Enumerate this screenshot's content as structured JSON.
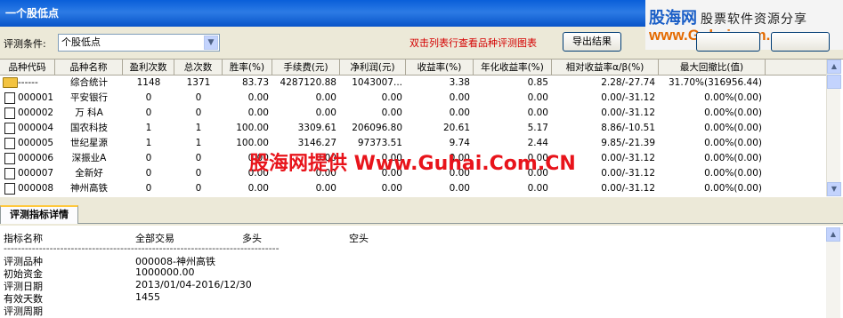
{
  "window": {
    "title": "一个股低点"
  },
  "watermark_logo": {
    "brand": "股海网",
    "slogan": "股票软件资源分享",
    "url": "www.Guhai.com.cn"
  },
  "condition": {
    "label": "评测条件:",
    "selected": "个股低点"
  },
  "hint": "双击列表行查看品种评测图表",
  "buttons": {
    "export": "导出结果"
  },
  "table": {
    "columns": [
      "品种代码",
      "品种名称",
      "盈利次数",
      "总次数",
      "胜率(%)",
      "手续费(元)",
      "净利润(元)",
      "收益率(%)",
      "年化收益率(%)",
      "相对收益率α/β(%)",
      "最大回撤比(值)"
    ],
    "rows": [
      {
        "icon": "folder",
        "code": "------",
        "name": "综合统计",
        "wins": "1148",
        "total": "1371",
        "winrate": "83.73",
        "fee": "4287120.88",
        "profit": "1043007...",
        "ret": "3.38",
        "annual": "0.85",
        "relative": "2.28/-27.74",
        "maxdd": "31.70%(316956.44)"
      },
      {
        "icon": "doc",
        "code": "000001",
        "name": "平安银行",
        "wins": "0",
        "total": "0",
        "winrate": "0.00",
        "fee": "0.00",
        "profit": "0.00",
        "ret": "0.00",
        "annual": "0.00",
        "relative": "0.00/-31.12",
        "maxdd": "0.00%(0.00)"
      },
      {
        "icon": "doc",
        "code": "000002",
        "name": "万 科A",
        "wins": "0",
        "total": "0",
        "winrate": "0.00",
        "fee": "0.00",
        "profit": "0.00",
        "ret": "0.00",
        "annual": "0.00",
        "relative": "0.00/-31.12",
        "maxdd": "0.00%(0.00)"
      },
      {
        "icon": "doc",
        "code": "000004",
        "name": "国农科技",
        "wins": "1",
        "total": "1",
        "winrate": "100.00",
        "fee": "3309.61",
        "profit": "206096.80",
        "ret": "20.61",
        "annual": "5.17",
        "relative": "8.86/-10.51",
        "maxdd": "0.00%(0.00)"
      },
      {
        "icon": "doc",
        "code": "000005",
        "name": "世纪星源",
        "wins": "1",
        "total": "1",
        "winrate": "100.00",
        "fee": "3146.27",
        "profit": "97373.51",
        "ret": "9.74",
        "annual": "2.44",
        "relative": "9.85/-21.39",
        "maxdd": "0.00%(0.00)"
      },
      {
        "icon": "doc",
        "code": "000006",
        "name": "深振业A",
        "wins": "0",
        "total": "0",
        "winrate": "0.00",
        "fee": "0.00",
        "profit": "0.00",
        "ret": "0.00",
        "annual": "0.00",
        "relative": "0.00/-31.12",
        "maxdd": "0.00%(0.00)"
      },
      {
        "icon": "doc",
        "code": "000007",
        "name": "全新好",
        "wins": "0",
        "total": "0",
        "winrate": "0.00",
        "fee": "0.00",
        "profit": "0.00",
        "ret": "0.00",
        "annual": "0.00",
        "relative": "0.00/-31.12",
        "maxdd": "0.00%(0.00)"
      },
      {
        "icon": "doc",
        "code": "000008",
        "name": "神州高铁",
        "wins": "0",
        "total": "0",
        "winrate": "0.00",
        "fee": "0.00",
        "profit": "0.00",
        "ret": "0.00",
        "annual": "0.00",
        "relative": "0.00/-31.12",
        "maxdd": "0.00%(0.00)"
      }
    ]
  },
  "overlay_watermark": "股海网提供 Www.Guhai.Com.CN",
  "detail_tab": {
    "label": "评测指标详情"
  },
  "detail": {
    "headers": [
      "指标名称",
      "全部交易",
      "多头",
      "空头"
    ],
    "separator": "------------------------------------------------------------------------------",
    "items": [
      {
        "label": "评测品种",
        "value": "000008-神州高铁"
      },
      {
        "label": "初始资金",
        "value": "1000000.00"
      },
      {
        "label": "评测日期",
        "value": "2013/01/04-2016/12/30"
      },
      {
        "label": "有效天数",
        "value": "1455"
      },
      {
        "label": "评测周期",
        "value": ""
      }
    ]
  }
}
